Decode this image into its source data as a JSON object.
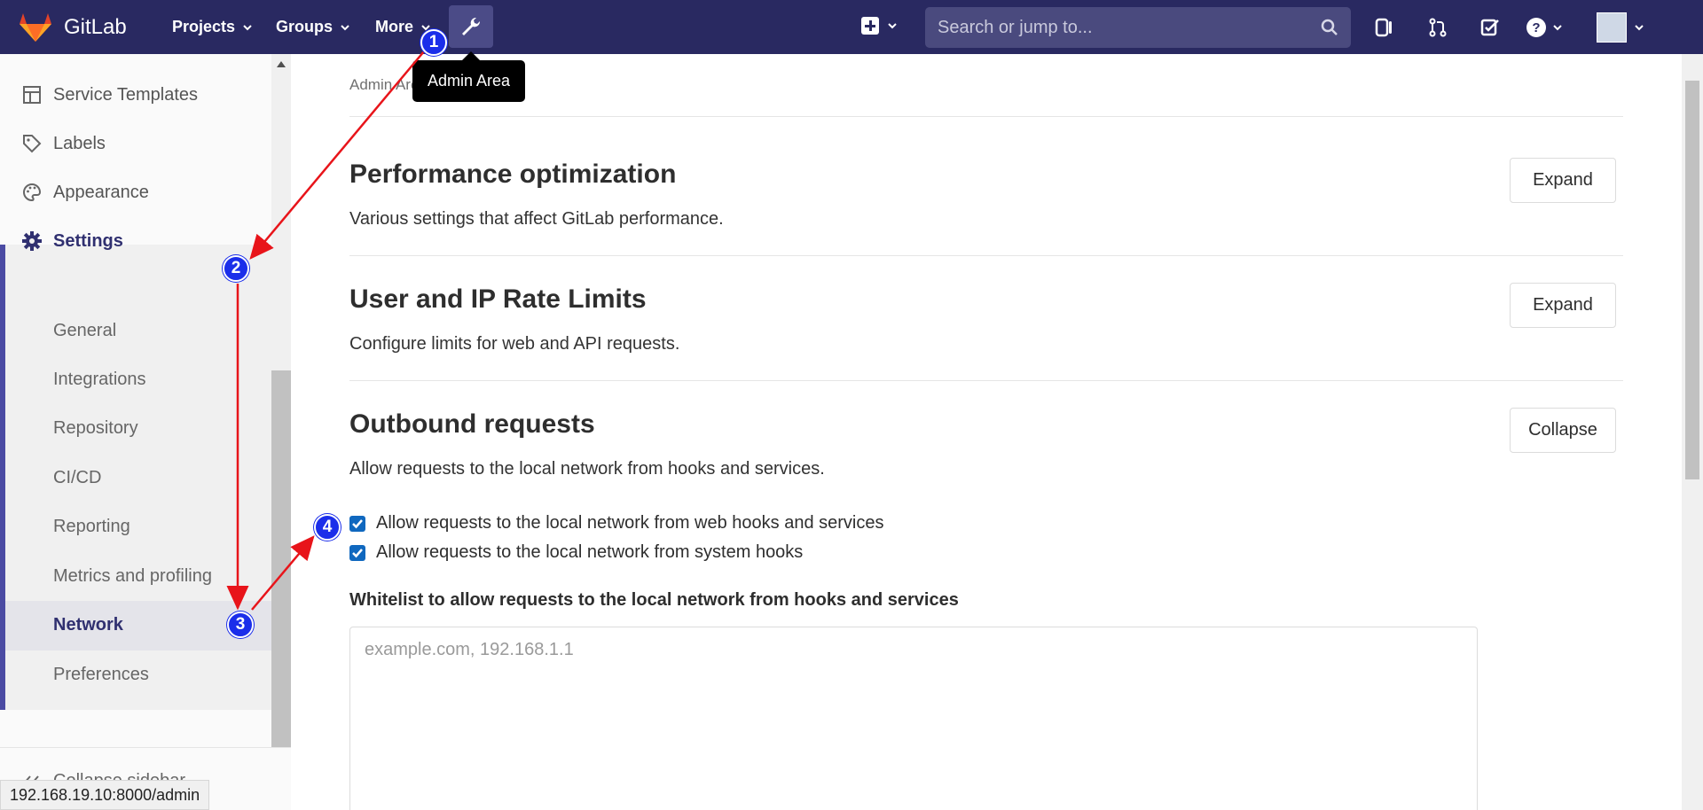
{
  "navbar": {
    "brand": "GitLab",
    "projects": "Projects",
    "groups": "Groups",
    "more": "More",
    "search_placeholder": "Search or jump to...",
    "admin_tooltip": "Admin Area",
    "bg_color": "#292961",
    "icons": [
      "wrench-icon",
      "plus-square-icon",
      "search-icon",
      "issues-icon",
      "merge-request-icon",
      "todo-icon",
      "help-icon",
      "avatar"
    ]
  },
  "sidebar": {
    "items": [
      {
        "label": "Service Templates",
        "icon": "template-icon"
      },
      {
        "label": "Labels",
        "icon": "tag-icon"
      },
      {
        "label": "Appearance",
        "icon": "palette-icon"
      },
      {
        "label": "Settings",
        "icon": "gear-icon"
      }
    ],
    "settings_sub": [
      {
        "label": "General"
      },
      {
        "label": "Integrations"
      },
      {
        "label": "Repository"
      },
      {
        "label": "CI/CD"
      },
      {
        "label": "Reporting"
      },
      {
        "label": "Metrics and profiling"
      },
      {
        "label": "Network",
        "active": true
      },
      {
        "label": "Preferences"
      }
    ],
    "collapse": "Collapse sidebar",
    "accent_color": "#4b4ba3"
  },
  "status_url": "192.168.19.10:8000/admin",
  "breadcrumb": "Admin Area > Network",
  "sections": [
    {
      "title": "Performance optimization",
      "desc": "Various settings that affect GitLab performance.",
      "button": "Expand"
    },
    {
      "title": "User and IP Rate Limits",
      "desc": "Configure limits for web and API requests.",
      "button": "Expand"
    },
    {
      "title": "Outbound requests",
      "desc": "Allow requests to the local network from hooks and services.",
      "button": "Collapse"
    }
  ],
  "outbound": {
    "checkbox1": "Allow requests to the local network from web hooks and services",
    "checkbox2": "Allow requests to the local network from system hooks",
    "checkbox1_checked": true,
    "checkbox2_checked": true,
    "whitelist_label": "Whitelist to allow requests to the local network from hooks and services",
    "whitelist_placeholder": "example.com, 192.168.1.1"
  },
  "annotations": {
    "steps": [
      "1",
      "2",
      "3",
      "4"
    ],
    "arrow_color": "#e8141a",
    "badge_color": "#1b2eea"
  }
}
